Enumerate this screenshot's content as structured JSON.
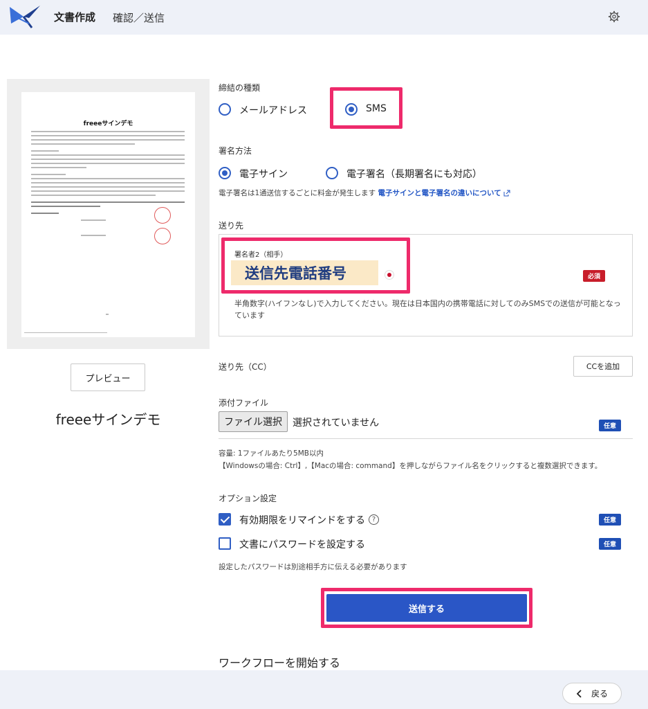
{
  "header": {
    "app_title": "文書作成",
    "page_title": "確認／送信"
  },
  "document": {
    "thumbnail_heading": "freeeサインデモ",
    "preview_label": "プレビュー",
    "title": "freeeサインデモ"
  },
  "contract_type": {
    "label": "締結の種類",
    "options": [
      {
        "label": "メールアドレス",
        "selected": false
      },
      {
        "label": "SMS",
        "selected": true
      }
    ]
  },
  "signing_method": {
    "label": "署名方法",
    "options": [
      {
        "label": "電子サイン",
        "selected": true
      },
      {
        "label": "電子署名（長期署名にも対応）",
        "selected": false
      }
    ],
    "note": "電子署名は1通送信するごとに料金が発生します",
    "note_link": "電子サインと電子署名の違いについて"
  },
  "recipient": {
    "label": "送り先",
    "signer_label": "署名者2（相手）",
    "phone_value": "送信先電話番号",
    "required_badge": "必須",
    "hint": "半角数字(ハイフンなし)で入力してください。現在は日本国内の携帯電話に対してのみSMSでの送信が可能となっています"
  },
  "cc": {
    "label": "送り先（CC）",
    "add_button": "CCを追加"
  },
  "attachment": {
    "label": "添付ファイル",
    "choose_button": "ファイル選択",
    "status": "選択されていません",
    "optional_badge": "任意",
    "note_line1": "容量: 1ファイルあたり5MB以内",
    "note_line2": "【Windowsの場合: Ctrl】,【Macの場合: command】を押しながらファイル名をクリックすると複数選択できます。"
  },
  "options": {
    "label": "オプション設定",
    "items": [
      {
        "label": "有効期限をリマインドをする",
        "checked": true,
        "badge": "任意"
      },
      {
        "label": "文書にパスワードを設定する",
        "checked": false,
        "badge": "任意"
      }
    ],
    "help_glyph": "?",
    "password_note": "設定したパスワードは別途相手方に伝える必要があります"
  },
  "actions": {
    "send_label": "送信する",
    "workflow_label": "ワークフローを開始する",
    "back_label": "戻る"
  },
  "colors": {
    "accent": "#2a56c6",
    "highlight": "#ee2a6b",
    "required": "#c81d2a",
    "header_bg": "#eef1f8"
  }
}
